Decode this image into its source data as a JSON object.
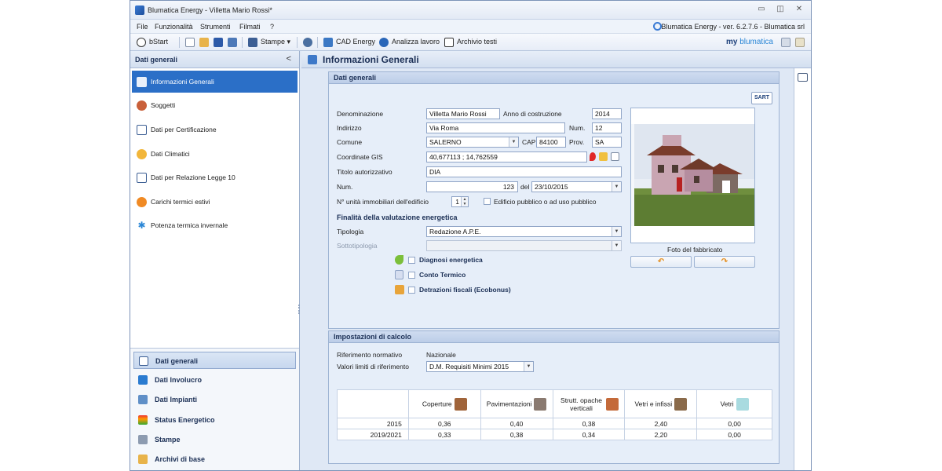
{
  "window": {
    "title": "Blumatica Energy - Villetta Mario Rossi*"
  },
  "menu": {
    "items": [
      "File",
      "Funzionalità",
      "Strumenti",
      "Filmati",
      "?"
    ],
    "version": "Blumatica Energy - ver. 6.2.7.6 - Blumatica srl"
  },
  "toolbar": {
    "bstart": "bStart",
    "stampe": "Stampe",
    "cad": "CAD Energy",
    "analizza": "Analizza lavoro",
    "archivio": "Archivio testi",
    "logo_my": "my",
    "logo_brand": "blumatica"
  },
  "sidebar": {
    "title": "Dati generali",
    "collapse": "<",
    "items": [
      "Informazioni Generali",
      "Soggetti",
      "Dati per Certificazione",
      "Dati Climatici",
      "Dati per Relazione Legge 10",
      "Carichi termici estivi",
      "Potenza termica invernale"
    ],
    "bottom": [
      "Dati generali",
      "Dati Involucro",
      "Dati Impianti",
      "Status Energetico",
      "Stampe",
      "Archivi di base"
    ]
  },
  "main": {
    "title": "Informazioni Generali"
  },
  "general": {
    "panel_title": "Dati generali",
    "sart_label": "SART",
    "labels": {
      "denominazione": "Denominazione",
      "anno": "Anno di costruzione",
      "indirizzo": "Indirizzo",
      "num_civico": "Num.",
      "comune": "Comune",
      "cap": "CAP",
      "prov": "Prov.",
      "gis": "Coordinate GIS",
      "titolo": "Titolo autorizzativo",
      "num": "Num.",
      "del": "del",
      "unita": "N° unità immobiliari dell'edificio",
      "pubblico": "Edificio pubblico o ad uso pubblico",
      "finalita": "Finalità della valutazione energetica",
      "tipologia": "Tipologia",
      "sottotipologia": "Sottotipologia",
      "diagnosi": "Diagnosi energetica",
      "conto": "Conto Termico",
      "detrazioni": "Detrazioni fiscali (Ecobonus)",
      "foto": "Foto del fabbricato"
    },
    "values": {
      "denominazione": "Villetta Mario Rossi",
      "anno": "2014",
      "indirizzo": "Via Roma",
      "num_civico": "12",
      "comune": "SALERNO",
      "cap": "84100",
      "prov": "SA",
      "gis": "40,677113 ; 14,762559",
      "titolo": "DIA",
      "num": "123",
      "del": "23/10/2015",
      "unita": "1",
      "tipologia": "Redazione A.P.E.",
      "sottotipologia": ""
    }
  },
  "calc": {
    "panel_title": "Impostazioni di calcolo",
    "labels": {
      "riferimento": "Riferimento normativo",
      "valori": "Valori limiti di riferimento"
    },
    "values": {
      "riferimento": "Nazionale",
      "valori": "D.M. Requisiti Minimi 2015"
    },
    "table": {
      "headers": [
        "Coperture",
        "Pavimentazioni",
        "Strutt. opache verticali",
        "Vetri e infissi",
        "Vetri"
      ],
      "rows": [
        {
          "year": "2015",
          "values": [
            "0,36",
            "0,40",
            "0,38",
            "2,40",
            "0,00"
          ]
        },
        {
          "year": "2019/2021",
          "values": [
            "0,33",
            "0,38",
            "0,34",
            "2,20",
            "0,00"
          ]
        }
      ]
    }
  },
  "colors": {
    "accent": "#2b6fc7",
    "header_text": "#1b2f55",
    "panel_bg": "#e6eef9"
  }
}
